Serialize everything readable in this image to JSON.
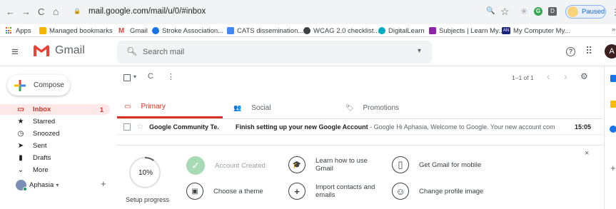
{
  "browser": {
    "back": "←",
    "forward": "→",
    "reload": "C",
    "home": "⌂",
    "lock": "🔒",
    "url": "mail.google.com/mail/u/0/#inbox",
    "zoom_icon": "🔍",
    "star_icon": "☆",
    "ext1": "✳",
    "ext2": "G",
    "ext3": "D",
    "profile_status": "Paused",
    "menu": "⋮",
    "bookmarks": [
      {
        "label": "Apps",
        "color": "#4285f4"
      },
      {
        "label": "Managed bookmarks",
        "color": "#f4b400"
      },
      {
        "label": "Gmail",
        "color": "#ea4335"
      },
      {
        "label": "Stroke Association...",
        "color": "#1a73e8"
      },
      {
        "label": "CATS dissemination...",
        "color": "#4285f4"
      },
      {
        "label": "WCAG 2.0 checklist...",
        "color": "#3c4043"
      },
      {
        "label": "DigitalLearn",
        "color": "#00acc1"
      },
      {
        "label": "Subjects | Learn My...",
        "color": "#8e24aa"
      },
      {
        "label": "My Computer My...",
        "color": "#1a237e"
      }
    ],
    "bookmark_more": "»",
    "mycomputer_badge": "AN"
  },
  "header": {
    "menu_icon": "≡",
    "logo_text": "Gmail",
    "search_placeholder": "Search mail",
    "search_dropdown": "▾",
    "help_icon": "?",
    "apps_icon": "⠿",
    "avatar_letter": "A"
  },
  "sidebar": {
    "compose_label": "Compose",
    "items": [
      {
        "label": "Inbox",
        "icon": "▭",
        "count": "1"
      },
      {
        "label": "Starred",
        "icon": "★",
        "count": ""
      },
      {
        "label": "Snoozed",
        "icon": "◷",
        "count": ""
      },
      {
        "label": "Sent",
        "icon": "➤",
        "count": ""
      },
      {
        "label": "Drafts",
        "icon": "▮",
        "count": ""
      },
      {
        "label": "More",
        "icon": "⌄",
        "count": ""
      }
    ],
    "hangouts_user": "Aphasia",
    "hangouts_caret": "▾",
    "hangouts_add": "+"
  },
  "toolbar": {
    "select_caret": "▾",
    "refresh": "C",
    "more": "⋮",
    "pagination": "1–1 of 1",
    "prev": "‹",
    "next": "›",
    "settings": "⚙"
  },
  "tabs": [
    {
      "label": "Primary",
      "icon": "▭"
    },
    {
      "label": "Social",
      "icon": "👥"
    },
    {
      "label": "Promotions",
      "icon": "🏷"
    }
  ],
  "emails": [
    {
      "sender": "Google Community Te.",
      "subject": "Finish setting up your new Google Account",
      "snippet": " - Google Hi Aphasia, Welcome to Google. Your new account com...",
      "time": "15:05"
    }
  ],
  "setup": {
    "progress_percent": "10%",
    "progress_fraction": 0.1,
    "progress_label": "Setup progress",
    "close": "×",
    "items": [
      {
        "label": "Account Created",
        "icon": "✓",
        "done": true
      },
      {
        "label": "Learn how to use Gmail",
        "icon": "🎓",
        "done": false
      },
      {
        "label": "Get Gmail for mobile",
        "icon": "▯",
        "done": false
      },
      {
        "label": "Choose a theme",
        "icon": "▣",
        "done": false
      },
      {
        "label": "Import contacts and emails",
        "icon": "+",
        "done": false
      },
      {
        "label": "Change profile image",
        "icon": "☺",
        "done": false
      }
    ]
  },
  "sidepanel": {
    "calendar_color": "#1a73e8",
    "keep_color": "#fbbc04",
    "tasks_color": "#1a73e8",
    "add": "+"
  }
}
